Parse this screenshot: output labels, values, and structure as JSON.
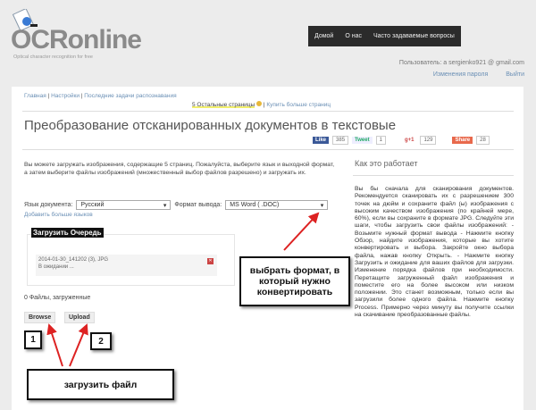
{
  "header": {
    "logo": "OCRonline",
    "tagline": "Optical character recognition for free",
    "nav": [
      "Домой",
      "О нас",
      "Часто задаваемые вопросы"
    ],
    "user": "Пользователь: a sergienko921 @ gmail.com",
    "change_password": "Изменения пароля",
    "logout": "Выйти"
  },
  "breadcrumbs": [
    "Главная",
    "Настройки",
    "Последние задачи распознавания"
  ],
  "pages_left": "5 Остальные страницы",
  "buy_pages": "Купить больше страниц",
  "page_title": "Преобразование отсканированных документов в текстовые",
  "social": {
    "like": "Like",
    "like_count": "385",
    "tweet": "Tweet",
    "tweet_count": "1",
    "gplus": "g+1",
    "gplus_count": "129",
    "share": "Share",
    "share_count": "28"
  },
  "intro": "Вы можете загружать изображения, содержащие 5 страниц. Пожалуйста, выберите язык и выходной формат, а затем выберите файлы изображений (множественный выбор файлов разрешено) и загружать их.",
  "form": {
    "lang_label": "Язык документа:",
    "lang_value": "Русский",
    "format_label": "Формат вывода:",
    "format_value": "MS Word ( .DOC)",
    "add_lang": "Добавить больше языков"
  },
  "queue": {
    "title": "Загрузить Очередь",
    "file_name": "2014-01-30_141202 (3), JPG",
    "file_status": "В ожидании ...",
    "count": "0 Файлы, загруженные"
  },
  "buttons": {
    "browse": "Browse",
    "upload": "Upload"
  },
  "annotations": {
    "format": "выбрать формат, в который нужно конвертировать",
    "one": "1",
    "two": "2",
    "upload": "загрузить файл"
  },
  "how": {
    "title": "Как это работает",
    "text": "Вы бы сначала для сканирования документов. Рекомендуется сканировать их с разрешением 300 точек на дюйм и сохраните файл (ы) изображения с высоким качеством изображения (по крайней мере, 60%), если вы сохраните в формате JPG. Следуйте эти шаги, чтобы загрузить свои файлы изображений: - Возьмите нужный формат вывода - Нажмите кнопку Обзор, найдите изображения, которые вы хотите конвертировать и выбора. Закройте окно выбора файла, нажав кнопку Открыть. - Нажмите кнопку Загрузить и ожидание для ваших файлов для загрузки. Изменение порядка файлов при необходимости. Перетащите загруженный файл изображения и поместите его на более высоком или низком положении. Это станет возможным, только если вы загрузили более одного файла. Нажмите кнопку Process. Примерно через минуту вы получите ссылки на скачивание преобразованные файлы."
  }
}
